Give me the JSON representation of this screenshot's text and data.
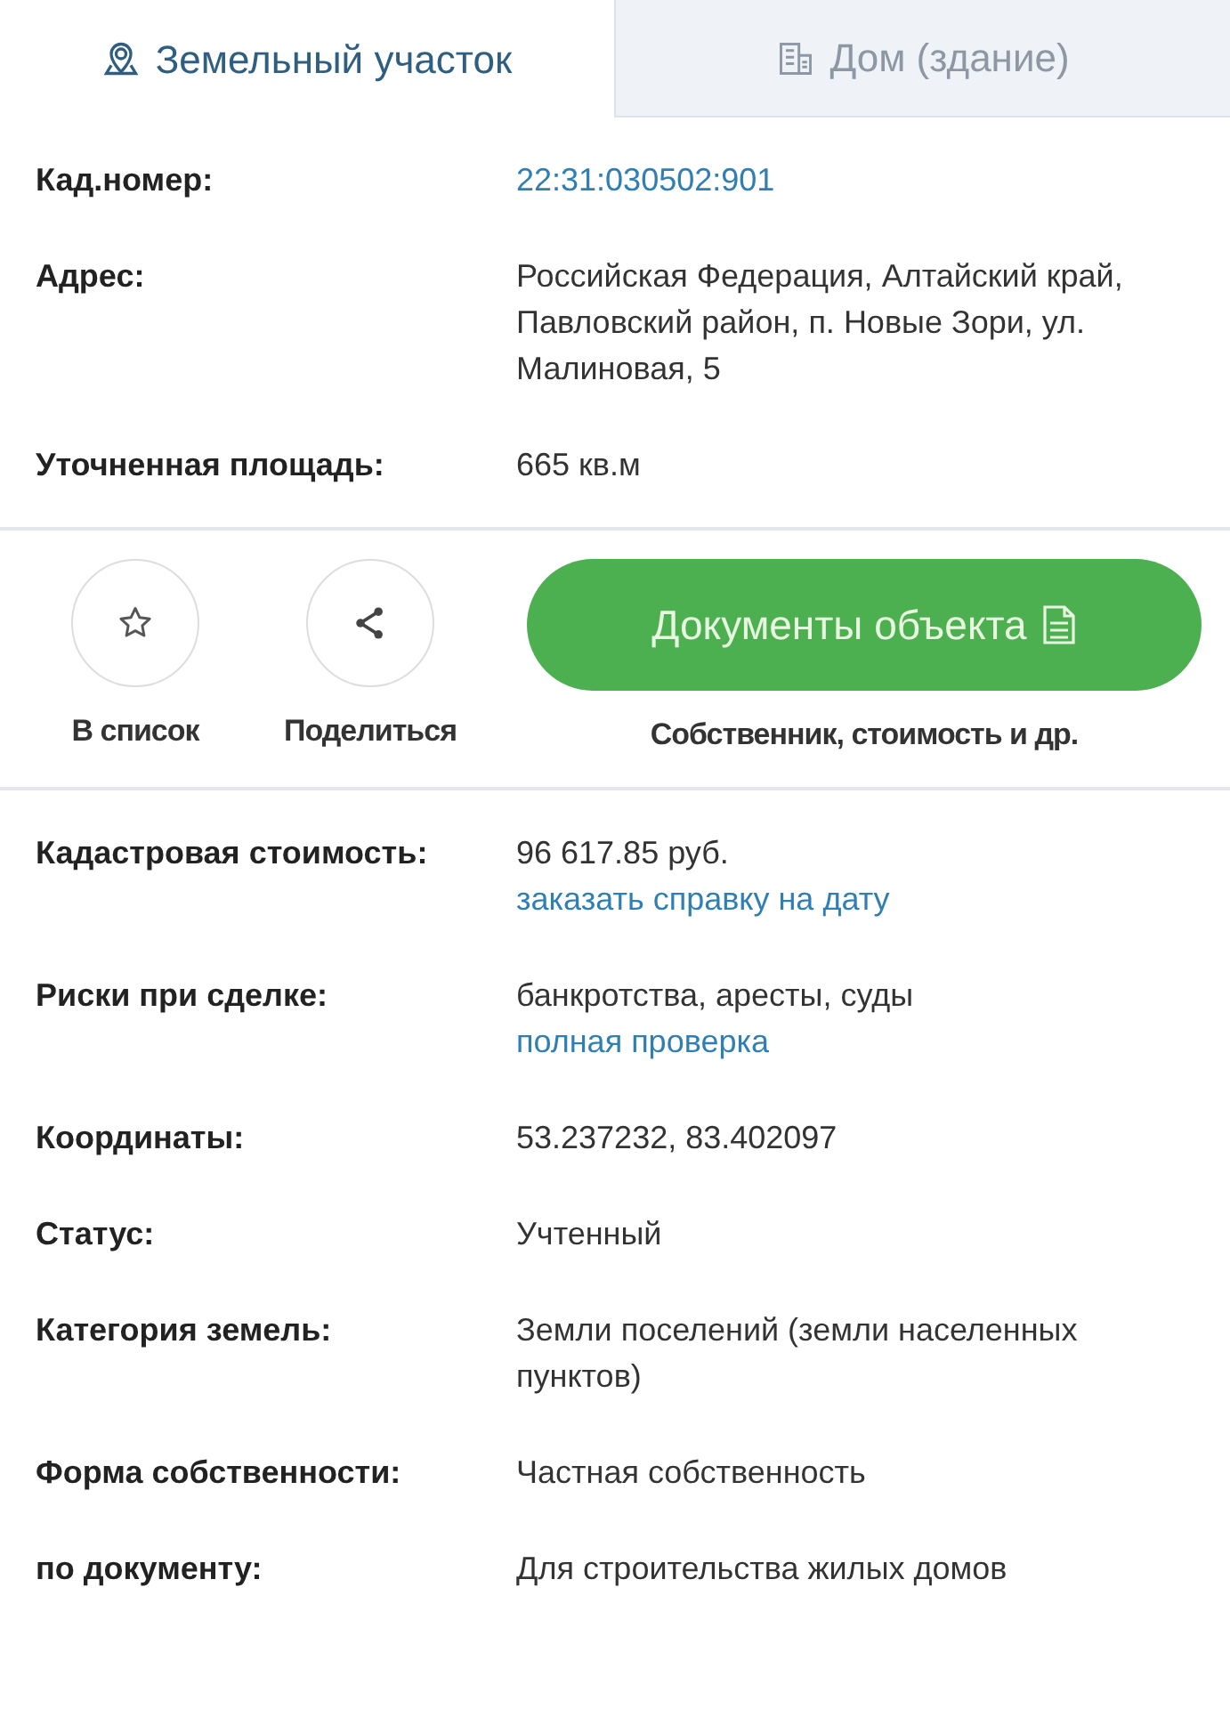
{
  "tabs": [
    {
      "label": "Земельный участок",
      "kind": "pin",
      "selected": true
    },
    {
      "label": "Дом (здание)",
      "kind": "building",
      "selected": false
    }
  ],
  "sections": [
    {
      "rows": [
        {
          "label": "Кад.номер:",
          "values": [
            {
              "kind": "link",
              "text": "22:31:030502:901"
            }
          ]
        },
        {
          "label": "Адрес:",
          "values": [
            {
              "kind": "text",
              "text": "Российская Федерация, Алтайский край, Павловский район, п. Новые Зори, ул. Малиновая, 5"
            }
          ]
        },
        {
          "label": "Уточненная площадь:",
          "values": [
            {
              "kind": "text",
              "text": "665 кв.м"
            }
          ]
        }
      ]
    },
    {
      "actions": [
        {
          "kind": "star",
          "label": "В список"
        },
        {
          "kind": "share",
          "label": "Поделиться"
        }
      ],
      "documents": {
        "label": "Документы объекта",
        "caption": "Собственник, стоимость и др."
      }
    },
    {
      "rows": [
        {
          "label": "Кадастровая стоимость:",
          "values": [
            {
              "kind": "text",
              "text": "96 617.85 руб."
            },
            {
              "kind": "link",
              "text": "заказать справку на дату"
            }
          ]
        },
        {
          "label": "Риски при сделке:",
          "values": [
            {
              "kind": "text",
              "text": "банкротства, аресты, суды"
            },
            {
              "kind": "link",
              "text": "полная проверка"
            }
          ]
        },
        {
          "label": "Координаты:",
          "values": [
            {
              "kind": "text",
              "text": "53.237232, 83.402097"
            }
          ]
        },
        {
          "label": "Статус:",
          "values": [
            {
              "kind": "text",
              "text": "Учтенный"
            }
          ]
        },
        {
          "label": "Категория земель:",
          "values": [
            {
              "kind": "text",
              "text": "Земли поселений (земли населенных пунктов)"
            }
          ]
        },
        {
          "label": "Форма собственности:",
          "values": [
            {
              "kind": "text",
              "text": "Частная собственность"
            }
          ]
        },
        {
          "label": "по документу:",
          "values": [
            {
              "kind": "text",
              "text": "Для строительства жилых домов"
            }
          ]
        }
      ]
    }
  ]
}
